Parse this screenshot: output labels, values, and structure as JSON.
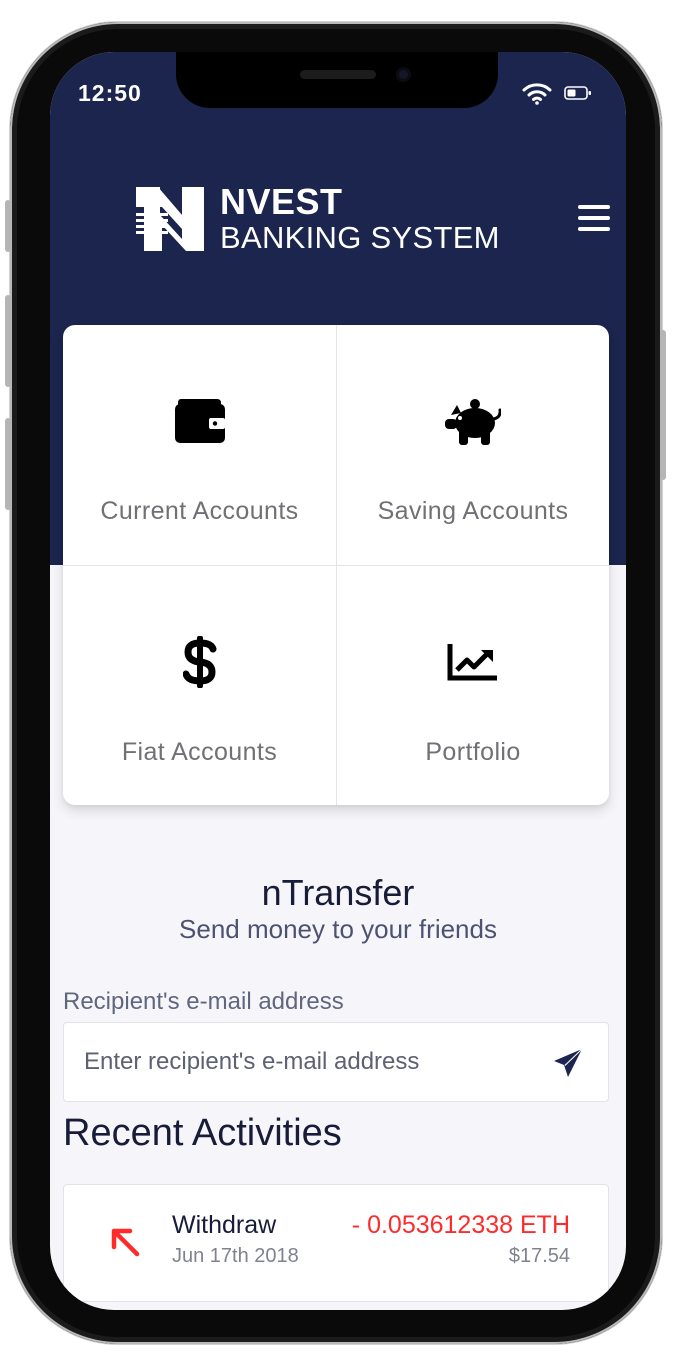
{
  "status_bar": {
    "time": "12:50",
    "wifi_icon": "wifi-icon",
    "battery_icon": "battery-icon"
  },
  "header": {
    "brand_name": "NVEST",
    "brand_subtitle": "BANKING SYSTEM",
    "menu_icon": "hamburger-menu-icon",
    "background_color": "#1b254d"
  },
  "accounts": [
    {
      "label": "Current Accounts",
      "icon": "wallet-icon"
    },
    {
      "label": "Saving Accounts",
      "icon": "piggy-bank-icon"
    },
    {
      "label": "Fiat Accounts",
      "icon": "dollar-icon"
    },
    {
      "label": "Portfolio",
      "icon": "chart-line-icon"
    }
  ],
  "ntransfer": {
    "title": "nTransfer",
    "subtitle": "Send money to your friends",
    "field_label": "Recipient's e-mail address",
    "input_placeholder": "Enter recipient's e-mail address",
    "input_value": "",
    "send_icon": "paper-plane-icon"
  },
  "recent": {
    "title": "Recent Activities",
    "items": [
      {
        "type": "Withdraw",
        "date": "Jun 17th 2018",
        "amount": "- 0.053612338 ETH",
        "fiat": "$17.54",
        "icon": "arrow-up-left-icon",
        "amount_color": "#ff2b2b"
      }
    ]
  }
}
